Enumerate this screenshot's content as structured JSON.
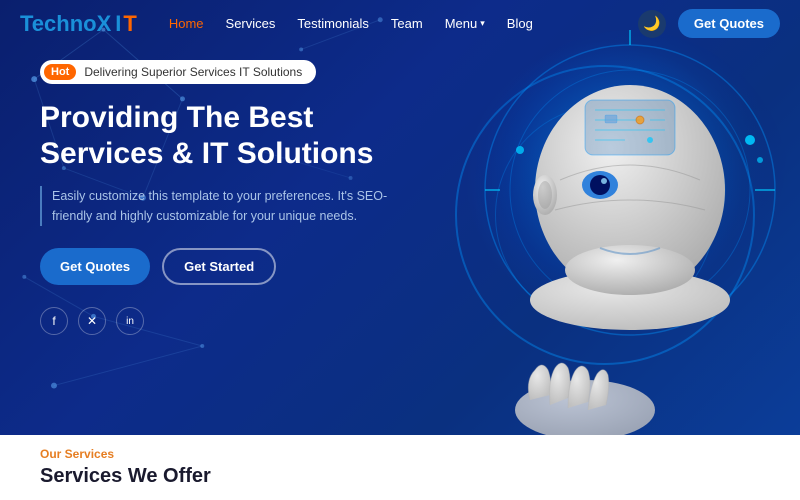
{
  "brand": {
    "name_blue": "TechnoX",
    "name_white": " ",
    "badge": "IT",
    "logo_it_color": "#ff6600"
  },
  "nav": {
    "links": [
      {
        "label": "Home",
        "active": true
      },
      {
        "label": "Services",
        "active": false
      },
      {
        "label": "Testimonials",
        "active": false
      },
      {
        "label": "Team",
        "active": false
      },
      {
        "label": "Menu",
        "active": false,
        "has_dropdown": true
      },
      {
        "label": "Blog",
        "active": false
      }
    ],
    "get_quotes": "Get Quotes"
  },
  "hero": {
    "badge_hot": "Hot",
    "badge_text": "Delivering Superior Services IT Solutions",
    "title_line1": "Providing The Best",
    "title_line2": "Services & IT Solutions",
    "subtitle": "Easily customize this template to your preferences. It's SEO-friendly and highly customizable for your unique needs.",
    "btn_primary": "Get Quotes",
    "btn_secondary": "Get Started",
    "social": [
      "f",
      "✕",
      "in"
    ]
  },
  "bottom": {
    "our_services_label": "Our Services",
    "services_title": "Services We Offer"
  },
  "colors": {
    "accent_orange": "#ff6600",
    "accent_blue": "#1a6bcc",
    "bg_dark": "#0a1f6e",
    "text_white": "#ffffff"
  }
}
